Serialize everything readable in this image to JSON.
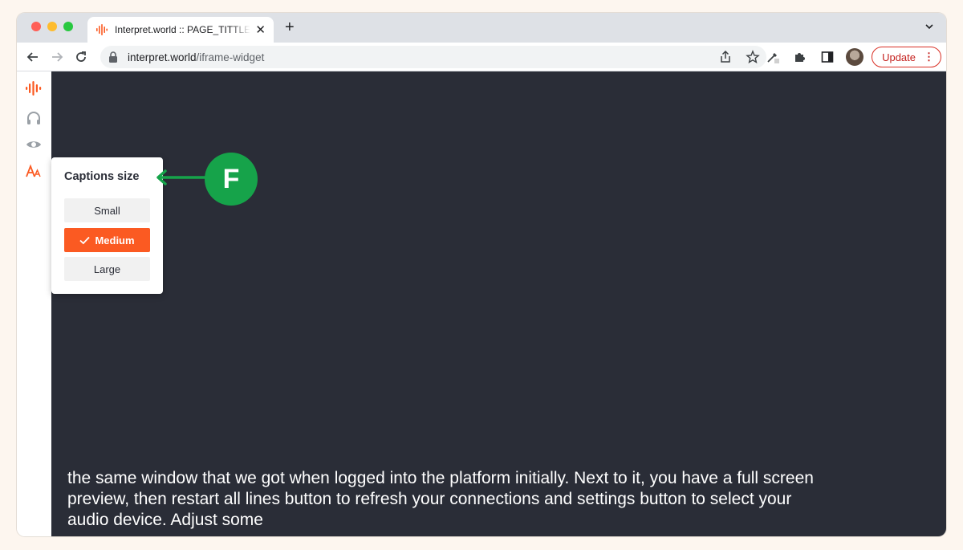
{
  "browser": {
    "tab_title": "Interpret.world :: PAGE_TITTLE",
    "tab_close": "✕",
    "new_tab": "+",
    "url_host": "interpret.world",
    "url_path": "/iframe-widget",
    "update_label": "Update",
    "update_menu": "⋮"
  },
  "sidebar": {
    "items": [
      {
        "icon": "interpret-logo-icon"
      },
      {
        "icon": "headphones-icon"
      },
      {
        "icon": "eye-icon"
      },
      {
        "icon": "text-size-icon"
      }
    ]
  },
  "captions_popup": {
    "title": "Captions size",
    "options": [
      {
        "label": "Small",
        "selected": false
      },
      {
        "label": "Medium",
        "selected": true
      },
      {
        "label": "Large",
        "selected": false
      }
    ]
  },
  "captions": {
    "line1": "the same window that we got when logged into the platform initially. Next to it, you have a full screen",
    "line2": "preview, then restart all lines button to refresh your connections and settings button to select your",
    "line3": "audio device. Adjust some"
  },
  "annotation": {
    "label": "F"
  },
  "colors": {
    "brand": "#fb5a22",
    "stage_bg": "#2a2d37",
    "annotation": "#16a34a"
  }
}
